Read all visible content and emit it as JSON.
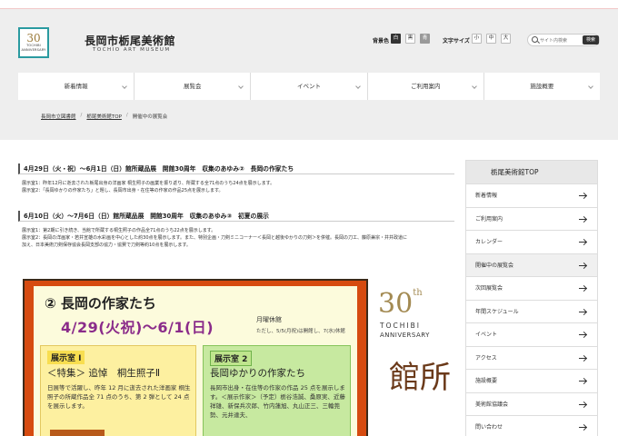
{
  "header": {
    "title": "長岡市栃尾美術館",
    "subtitle": "TOCHIO ART MUSEUM",
    "logo_text": "30",
    "logo_sub1": "TOCHIBI",
    "logo_sub2": "ANNIVERSARY"
  },
  "controls": {
    "bg_label": "背景色",
    "bg_options": [
      "白",
      "黒",
      "青"
    ],
    "size_label": "文字サイズ",
    "size_options": [
      "小",
      "中",
      "大"
    ],
    "search_placeholder": "サイト内検索",
    "search_button": "検索"
  },
  "nav": [
    "新着情報",
    "展覧会",
    "イベント",
    "ご利用案内",
    "施設概要"
  ],
  "breadcrumb": [
    "長岡市立図書館",
    "栃尾美術館TOP",
    "開催中の展覧会"
  ],
  "exhibitions": [
    {
      "title": "4月29日（火・祝）〜6月1日（日）館所蔵品展　開館30周年　収集のあゆみ②　長岡の作家たち",
      "lines": [
        "展示室1：昨年12月に逝去された栃尾出身の洋画家 桐生照子の画業を振り返り、所蔵する全71点のうち24点を展示します。",
        "展示室2：「長岡ゆかりの作家たち」と題し、長岡市出身・在住等の作家の作品25点を展示します。"
      ]
    },
    {
      "title": "6月10日（火）〜7月6日（日）館所蔵品展　開館30周年　収集のあゆみ③　初夏の展示",
      "lines": [
        "展示室1：第2期に引き続き、当館で所蔵する桐生照子の作品全71点のうち22点を展示します。",
        "展示室2：長岡の洋画家・若井宣雄の水彩画を中心とした約30点を展示します。また、特別企画・刀剣ミニコーナー＜長岡と越後ゆかりの刀剣＞を併催。長岡の刀工、藤原兼宗・井井政道に",
        "加え、日本美術刀剣保存協会長岡支部の協力・協賛で刀剣等約10点を展示します。"
      ]
    }
  ],
  "poster": {
    "title": "②  長岡の作家たち",
    "dates": "4/29(火祝)〜6/1(日)",
    "closed": "月曜休館",
    "closed_note": "ただし、5/5(月祝)は開館し、7(水)休館",
    "room1_label": "展示室 I",
    "room1_head": "＜特集＞ 追悼　桐生照子Ⅱ",
    "room1_body": "日展等で活躍し、昨年 12 月に逝去された洋画家 桐生照子の所蔵作品全 71 点のうち、第 2 弾として 24 点を展示します。",
    "room2_label": "展示室 2",
    "room2_head": "長岡ゆかりの作家たち",
    "room2_body": "長岡市出身・在住等の作家の作品 25 点を展示します。＜展示作家＞（予定）栃谷浩誠、桑原実、近藤祥雄、新保兵次郎、竹内蓮旭、丸山正三、三輪莞勢、元井達夫、",
    "right_30": "30",
    "right_th": "th",
    "right_tochibi": "TOCHIBI",
    "right_anniv": "ANNIVERSARY",
    "right_kanji": "館所"
  },
  "sidebar": {
    "head": "栃尾美術館TOP",
    "items": [
      "新着情報",
      "ご利用案内",
      "カレンダー",
      "開催中の展覧会",
      "次回展覧会",
      "年間スケジュール",
      "イベント",
      "アクセス",
      "施設概要",
      "美術館協議会",
      "問い合わせ"
    ]
  }
}
